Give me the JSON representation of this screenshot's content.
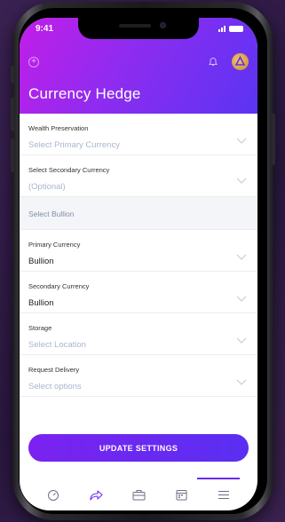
{
  "status_bar": {
    "time": "9:41"
  },
  "header": {
    "title": "Currency Hedge"
  },
  "form": {
    "wealth_preservation": {
      "label": "Wealth Preservation",
      "value": "Select Primary Currency"
    },
    "secondary_currency_select": {
      "label": "Select Secondary Currency",
      "value": "(Optional)"
    },
    "bullion_section": {
      "title": "Select Bullion"
    },
    "primary_currency": {
      "label": "Primary Currency",
      "value": "Bullion"
    },
    "secondary_currency": {
      "label": "Secondary Currency",
      "value": "Bullion"
    },
    "storage": {
      "label": "Storage",
      "value": "Select Location"
    },
    "request_delivery": {
      "label": "Request Delivery",
      "value": "Select options"
    }
  },
  "actions": {
    "update_label": "UPDATE SETTINGS"
  },
  "tabbar": {
    "items": [
      "speedometer-icon",
      "share-arrow-icon",
      "briefcase-icon",
      "calendar-icon",
      "menu-icon"
    ],
    "active": "menu-icon"
  },
  "colors": {
    "accent": "#6a2cf2",
    "header_start": "#c21ee8",
    "header_end": "#5b34f3",
    "placeholder": "#a9b6cc"
  }
}
